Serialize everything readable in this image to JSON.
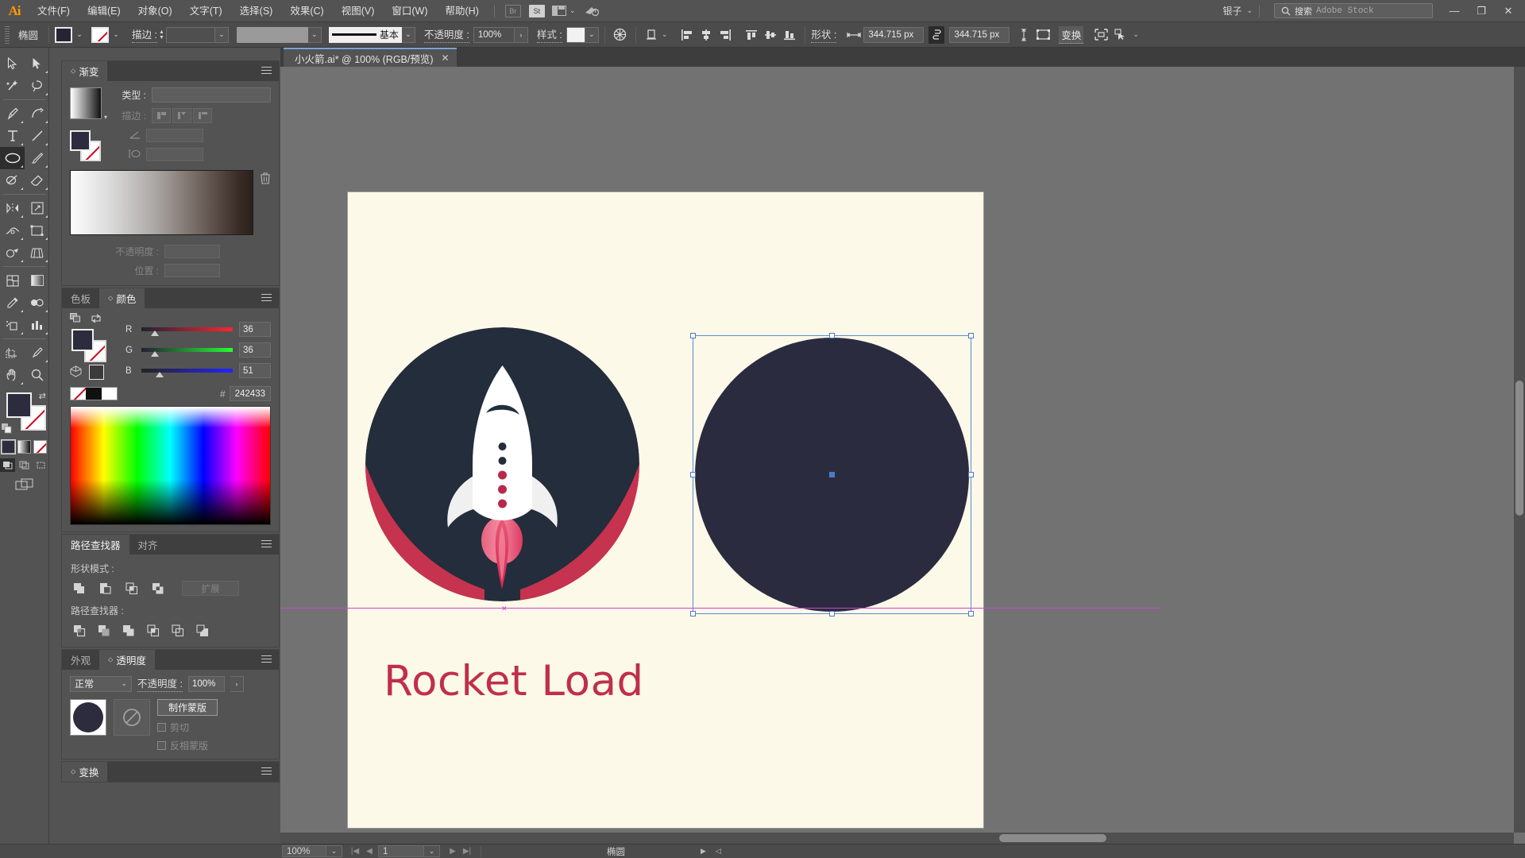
{
  "app": {
    "name": "Ai",
    "logo_color": "#ff9a00",
    "user": "银子",
    "stock_search_label": "搜索",
    "stock_search_placeholder": "Adobe Stock",
    "bridge_label": "Br",
    "stock_label": "St"
  },
  "menu": {
    "items": [
      {
        "label": "文件(F)"
      },
      {
        "label": "编辑(E)"
      },
      {
        "label": "对象(O)"
      },
      {
        "label": "文字(T)"
      },
      {
        "label": "选择(S)"
      },
      {
        "label": "效果(C)"
      },
      {
        "label": "视图(V)"
      },
      {
        "label": "窗口(W)"
      },
      {
        "label": "帮助(H)"
      }
    ]
  },
  "window_controls": {
    "minimize": "—",
    "restore": "❐",
    "close": "✕"
  },
  "control_bar": {
    "object_type": "椭圆",
    "fill_color": "#242433",
    "stroke_label": "描边 :",
    "stroke_weight": "",
    "stroke_profile_label": "基本",
    "opacity_label": "不透明度 :",
    "opacity_value": "100%",
    "style_label": "样式 :",
    "shape_label": "形状 :",
    "width_value": "344.715 px",
    "height_value": "344.715 px",
    "transform_label": "变换"
  },
  "gradient_panel": {
    "tab": "渐变",
    "type_label": "类型 :",
    "type_value": "",
    "stroke_label": "描边 :",
    "angle_value": "",
    "aspect_value": "",
    "opacity_label": "不透明度 :",
    "opacity_value": "",
    "location_label": "位置 :",
    "location_value": ""
  },
  "color_panel": {
    "tabs": [
      {
        "label": "色板",
        "active": false
      },
      {
        "label": "颜色",
        "active": true
      }
    ],
    "channels": [
      {
        "name": "R",
        "value": "36"
      },
      {
        "name": "G",
        "value": "36"
      },
      {
        "name": "B",
        "value": "51"
      }
    ],
    "hex_symbol": "#",
    "hex_value": "242433",
    "fill_color": "#242433"
  },
  "pathfinder_panel": {
    "tabs": [
      {
        "label": "路径查找器",
        "active": true
      },
      {
        "label": "对齐",
        "active": false
      }
    ],
    "shape_modes_label": "形状模式 :",
    "expand_label": "扩展",
    "pathfinders_label": "路径查找器 :"
  },
  "transparency_panel": {
    "tabs": [
      {
        "label": "外观",
        "active": false
      },
      {
        "label": "透明度",
        "active": true
      }
    ],
    "blend_mode": "正常",
    "opacity_label": "不透明度 :",
    "opacity_value": "100%",
    "make_mask_label": "制作蒙版",
    "clip_label": "剪切",
    "invert_mask_label": "反相蒙版",
    "thumb_color": "#2c2c3e"
  },
  "transform_panel": {
    "tab": "变换"
  },
  "document": {
    "tab_title": "小火箭.ai* @ 100% (RGB/预览)",
    "close_glyph": "✕"
  },
  "artwork": {
    "background": "#fdf9e8",
    "title_text": "Rocket Load",
    "title_color": "#bf2f4c",
    "dark_navy": "#232d3b",
    "crimson": "#c5334f",
    "white": "#ffffff",
    "selected_shape_color": "#2b2b40",
    "guide_color": "#cc44cc"
  },
  "status_bar": {
    "zoom": "100%",
    "page": "1",
    "tool_name": "椭圆"
  }
}
